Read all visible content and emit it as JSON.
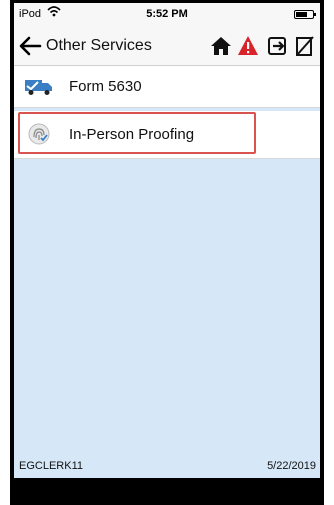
{
  "status_bar": {
    "carrier": "iPod",
    "time": "5:52 PM"
  },
  "nav": {
    "title": "Other Services"
  },
  "list": [
    {
      "label": "Form 5630",
      "icon": "truck-icon"
    },
    {
      "label": "In-Person Proofing",
      "icon": "fingerprint-icon",
      "highlighted": true
    }
  ],
  "footer": {
    "user": "EGCLERK11",
    "date": "5/22/2019"
  },
  "colors": {
    "background": "#d6e8f7",
    "alert": "#d9232b",
    "highlight_border": "#d9534f",
    "truck": "#3a7fc4"
  }
}
